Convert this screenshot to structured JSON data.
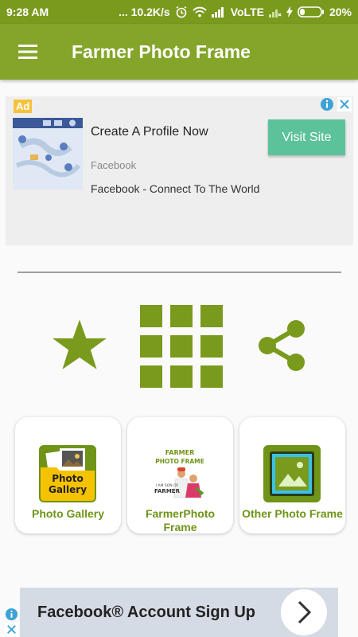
{
  "status_bar": {
    "time": "9:28 AM",
    "speed": "... 10.2K/s",
    "network": "VoLTE",
    "battery": "20%"
  },
  "app_bar": {
    "title": "Farmer Photo Frame",
    "menu_icon": "hamburger-menu-icon"
  },
  "ad": {
    "badge": "Ad",
    "headline": "Create A Profile Now",
    "advertiser": "Facebook",
    "body": "Facebook - Connect To The World",
    "cta": "Visit Site"
  },
  "actions": [
    {
      "icon": "star-icon"
    },
    {
      "icon": "grid-icon"
    },
    {
      "icon": "share-icon"
    }
  ],
  "tiles": [
    {
      "label": "Photo Gallery",
      "icon_text_1": "Photo",
      "icon_text_2": "Gallery"
    },
    {
      "label": "FarmerPhoto Frame",
      "icon_text_1": "FARMER",
      "icon_text_2": "PHOTO FRAME",
      "icon_text_3": "I AM SON OF",
      "icon_text_4": "FARMER"
    },
    {
      "label": "Other Photo Frame"
    }
  ],
  "banner": {
    "text": "Facebook® Account Sign Up"
  },
  "colors": {
    "primary": "#84a52a",
    "status_bar": "#7a9a1e",
    "icon_green": "#7a9a1e",
    "tile_label": "#6f9418",
    "ad_cta": "#5cc29a",
    "ad_badge": "#f5c23c"
  }
}
